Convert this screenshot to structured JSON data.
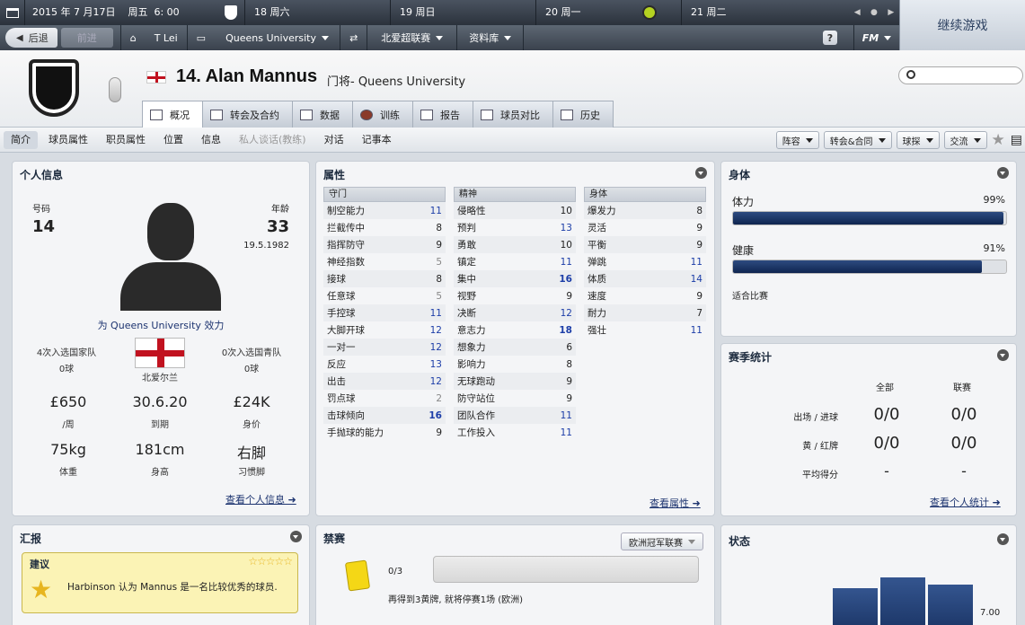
{
  "topbar": {
    "date": "2015 年 7 月17日",
    "weekday": "周五",
    "time": "6: 00",
    "days": [
      "18 周六",
      "19 周日",
      "20 周一",
      "21 周二"
    ]
  },
  "continue_label": "继续游戏",
  "navbar": {
    "back": "后退",
    "forward": "前进",
    "manager": "T Lei",
    "club": "Queens University",
    "league": "北爱超联赛",
    "database": "资料库",
    "help": "?",
    "fm": "FM"
  },
  "player": {
    "name": "14. Alan Mannus",
    "role": "门将- Queens University"
  },
  "tabs": [
    "概况",
    "转会及合约",
    "数据",
    "训练",
    "报告",
    "球员对比",
    "历史"
  ],
  "subtabs": [
    "简介",
    "球员属性",
    "职员属性",
    "位置",
    "信息",
    "私人谈话(教练)",
    "对话",
    "记事本"
  ],
  "subright": [
    "阵容",
    "转会&合同",
    "球探",
    "交流"
  ],
  "personal": {
    "title": "个人信息",
    "number_label": "号码",
    "number": "14",
    "age_label": "年龄",
    "age": "33",
    "dob": "19.5.1982",
    "plays_for": "为 Queens University 效力",
    "caps_label": "4次入选国家队",
    "caps_goals": "0球",
    "nation": "北爱尔兰",
    "youth_label": "0次入选国青队",
    "youth_goals": "0球",
    "wage": "£650",
    "wage_label": "/周",
    "expiry": "30.6.20",
    "expiry_label": "到期",
    "value": "£24K",
    "value_label": "身价",
    "weight": "75kg",
    "weight_label": "体重",
    "height": "181cm",
    "height_label": "身高",
    "foot": "右脚",
    "foot_label": "习惯脚",
    "link": "查看个人信息"
  },
  "attributes": {
    "title": "属性",
    "goalkeeping": {
      "header": "守门",
      "rows": [
        [
          "制空能力",
          "11"
        ],
        [
          "拦截传中",
          "8"
        ],
        [
          "指挥防守",
          "9"
        ],
        [
          "神经指数",
          "5"
        ],
        [
          "接球",
          "8"
        ],
        [
          "任意球",
          "5"
        ],
        [
          "手控球",
          "11"
        ],
        [
          "大脚开球",
          "12"
        ],
        [
          "一对一",
          "12"
        ],
        [
          "反应",
          "13"
        ],
        [
          "出击",
          "12"
        ],
        [
          "罚点球",
          "2"
        ],
        [
          "击球倾向",
          "16"
        ],
        [
          "手抛球的能力",
          "9"
        ]
      ]
    },
    "mental": {
      "header": "精神",
      "rows": [
        [
          "侵略性",
          "10"
        ],
        [
          "预判",
          "13"
        ],
        [
          "勇敢",
          "10"
        ],
        [
          "镇定",
          "11"
        ],
        [
          "集中",
          "16"
        ],
        [
          "视野",
          "9"
        ],
        [
          "决断",
          "12"
        ],
        [
          "意志力",
          "18"
        ],
        [
          "想象力",
          "6"
        ],
        [
          "影响力",
          "8"
        ],
        [
          "无球跑动",
          "9"
        ],
        [
          "防守站位",
          "9"
        ],
        [
          "团队合作",
          "11"
        ],
        [
          "工作投入",
          "11"
        ]
      ]
    },
    "physical": {
      "header": "身体",
      "rows": [
        [
          "爆发力",
          "8"
        ],
        [
          "灵活",
          "9"
        ],
        [
          "平衡",
          "9"
        ],
        [
          "弹跳",
          "11"
        ],
        [
          "体质",
          "14"
        ],
        [
          "速度",
          "9"
        ],
        [
          "耐力",
          "7"
        ],
        [
          "强壮",
          "11"
        ]
      ]
    },
    "link": "查看属性"
  },
  "physique": {
    "title": "身体",
    "condition_label": "体力",
    "condition": "99%",
    "condition_value": 0.99,
    "health_label": "健康",
    "health": "91%",
    "health_value": 0.91,
    "status": "适合比赛"
  },
  "season": {
    "title": "赛季统计",
    "col_all": "全部",
    "col_league": "联赛",
    "rows": [
      {
        "label": "出场 / 进球",
        "all": "0/0",
        "league": "0/0"
      },
      {
        "label": "黄 / 红牌",
        "all": "0/0",
        "league": "0/0"
      },
      {
        "label": "平均得分",
        "all": "-",
        "league": "-"
      }
    ],
    "link": "查看个人统计"
  },
  "report": {
    "title": "汇报",
    "advice_title": "建议",
    "stars": "☆☆☆☆☆",
    "text": "Harbinson 认为 Mannus 是一名比较优秀的球员."
  },
  "ban": {
    "title": "禁赛",
    "competition": "欧洲冠军联赛",
    "count": "0/3",
    "text": "再得到3黄牌, 就将停赛1场 (欧洲)"
  },
  "form": {
    "title": "状态",
    "value_label": "7.00",
    "bars": [
      0.6,
      0.75,
      0.65
    ]
  },
  "colors": {
    "accent": "#1d2b3e",
    "bar_fill": "#0f2550",
    "link": "#1d3470",
    "highlight_value": "#1d3ea8"
  }
}
